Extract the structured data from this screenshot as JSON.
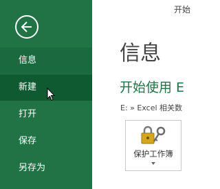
{
  "colors": {
    "accent": "#217346",
    "nav_hover": "#0f5a30",
    "nav_active": "#1b6a3f",
    "text": "#444444"
  },
  "window": {
    "title": "开始"
  },
  "sidebar": {
    "back_icon": "back-arrow-icon",
    "items": [
      {
        "label": "信息",
        "state": "active"
      },
      {
        "label": "新建",
        "state": "hover"
      },
      {
        "label": "打开",
        "state": "normal"
      },
      {
        "label": "保存",
        "state": "normal"
      },
      {
        "label": "另存为",
        "state": "normal"
      }
    ]
  },
  "main": {
    "title": "信息",
    "heading": "开始使用 E",
    "path": "E: » Excel 相关数",
    "protect_button": {
      "label": "保护工作簿",
      "icon": "lock-key-icon"
    }
  }
}
